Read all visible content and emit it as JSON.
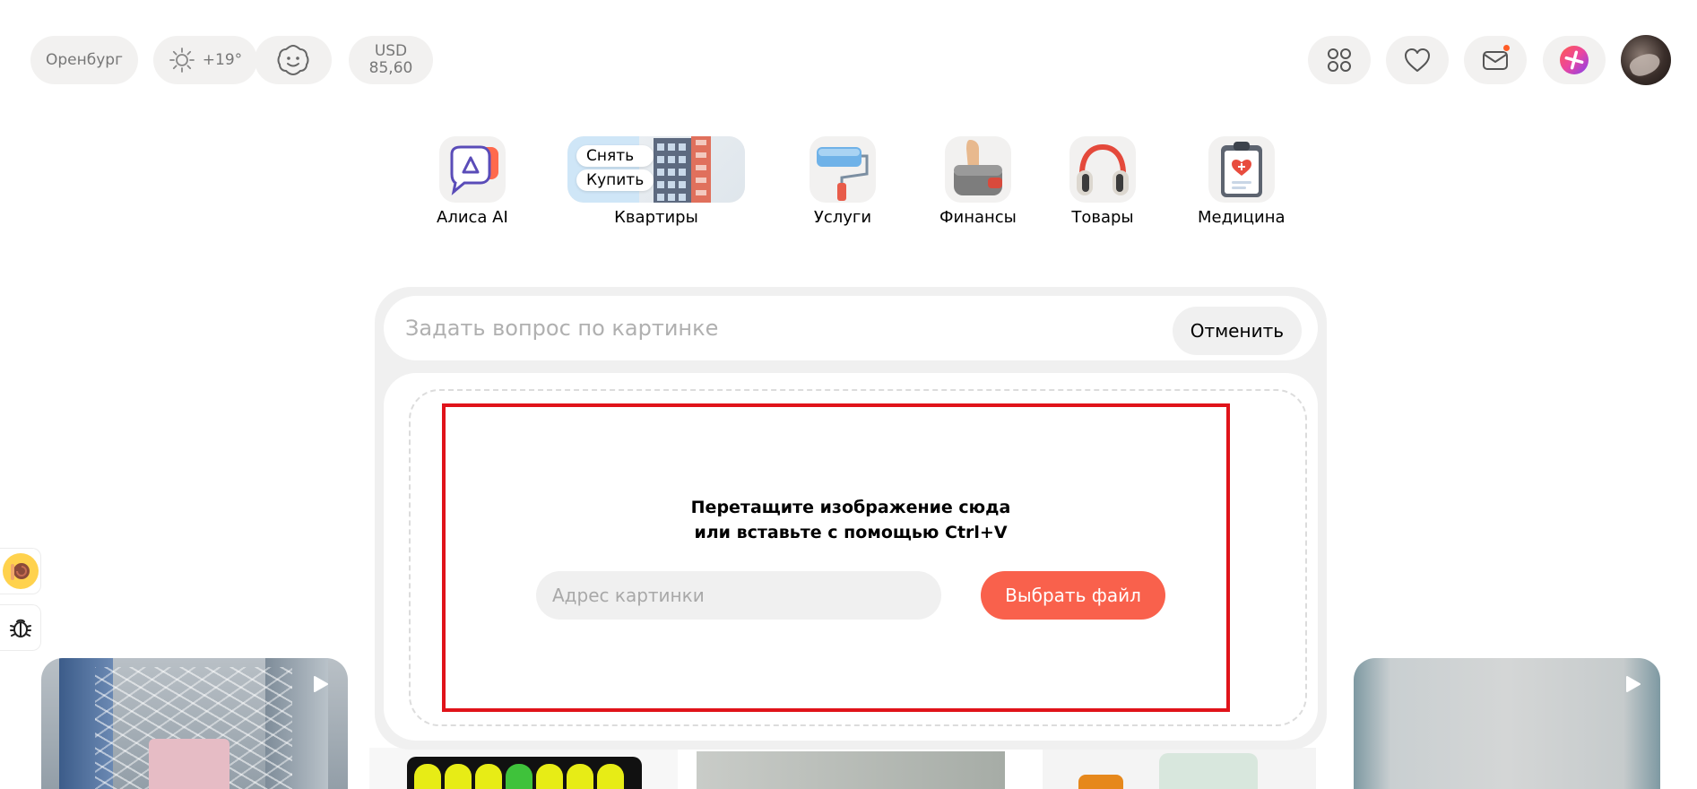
{
  "header": {
    "city": "Оренбург",
    "temperature": "+19°",
    "currency_code": "USD",
    "currency_rate": "85,60"
  },
  "services": [
    {
      "label": "Алиса AI",
      "icon": "alisa-icon"
    },
    {
      "label": "Квартиры",
      "icon": "building-icon",
      "chips": [
        "Снять",
        "Купить"
      ]
    },
    {
      "label": "Услуги",
      "icon": "paint-roller-icon"
    },
    {
      "label": "Финансы",
      "icon": "wallet-icon"
    },
    {
      "label": "Товары",
      "icon": "headphones-icon"
    },
    {
      "label": "Медицина",
      "icon": "clipboard-heart-icon"
    }
  ],
  "search": {
    "placeholder": "Задать вопрос по картинке",
    "cancel_label": "Отменить"
  },
  "upload": {
    "line1": "Перетащите изображение сюда",
    "line2": "или вставьте с помощью Ctrl+V",
    "url_placeholder": "Адрес картинки",
    "choose_label": "Выбрать файл"
  },
  "colors": {
    "accent": "#f9614c",
    "highlight": "#e0131a",
    "pill_bg": "#f2f1f0",
    "notification_dot": "#ff5c26"
  }
}
